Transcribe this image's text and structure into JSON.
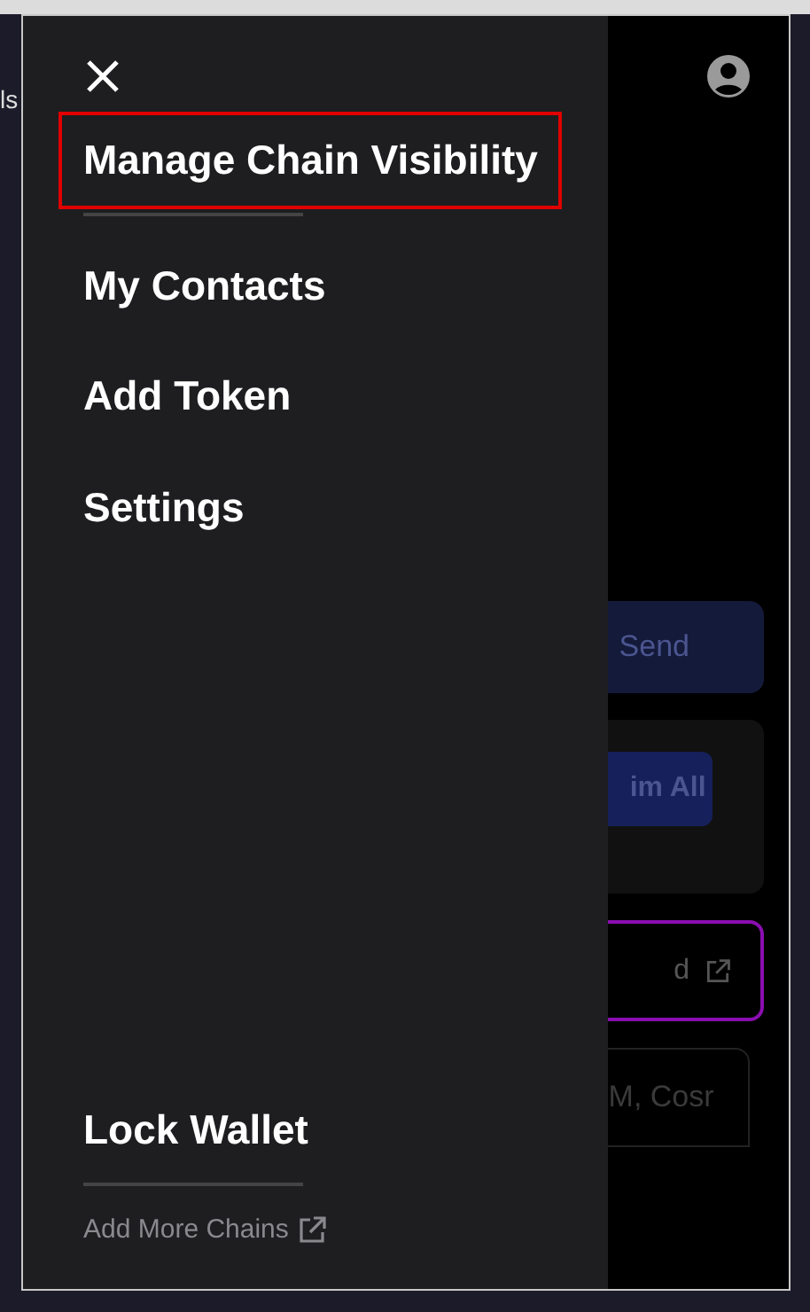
{
  "backdrop_text": "ls",
  "menu": {
    "items": [
      {
        "label": "Manage Chain Visibility",
        "highlighted": true,
        "divider_after": true
      },
      {
        "label": "My Contacts",
        "highlighted": false,
        "divider_after": false
      },
      {
        "label": "Add Token",
        "highlighted": false,
        "divider_after": false
      },
      {
        "label": "Settings",
        "highlighted": false,
        "divider_after": false
      }
    ],
    "lock_item": "Lock Wallet",
    "external_link": "Add More Chains"
  },
  "behind": {
    "send_button": "Send",
    "claim_button": "im All",
    "link_card": "d",
    "search_field": "M, Cosr"
  }
}
